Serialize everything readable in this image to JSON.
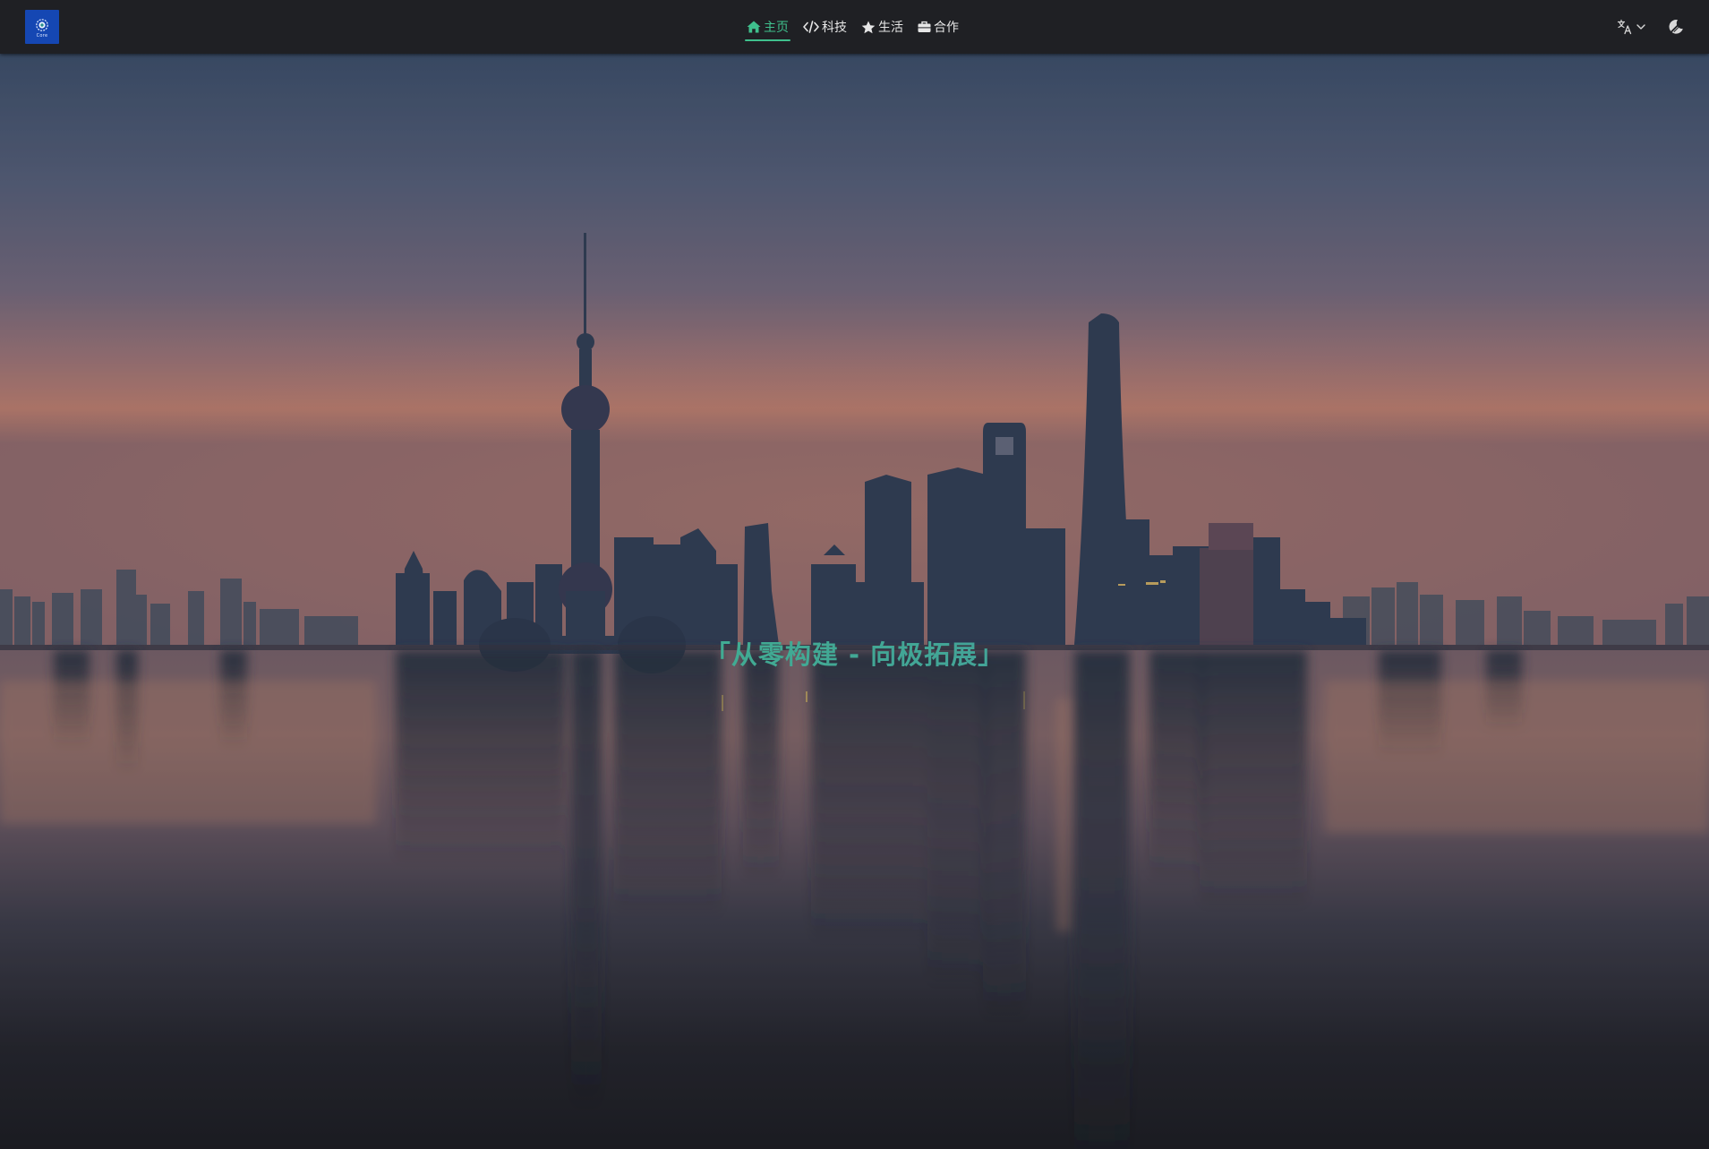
{
  "navbar": {
    "logo": {
      "text": "Core",
      "icon": "gear-icon",
      "bg_color": "#1547b3"
    },
    "menu": [
      {
        "label": "主页",
        "icon": "home-icon",
        "active": true
      },
      {
        "label": "科技",
        "icon": "code-icon",
        "active": false
      },
      {
        "label": "生活",
        "icon": "star-icon",
        "active": false
      },
      {
        "label": "合作",
        "icon": "briefcase-icon",
        "active": false
      }
    ],
    "language": {
      "icon": "translate-icon",
      "dropdown_icon": "chevron-down-icon"
    },
    "theme_toggle": {
      "icon": "moon-icon"
    },
    "accent_color": "#3fc08d"
  },
  "hero": {
    "title": "「从零构建 - 向极拓展」",
    "background": "city skyline at dawn reflected on water",
    "title_color": "#3eb58f"
  }
}
